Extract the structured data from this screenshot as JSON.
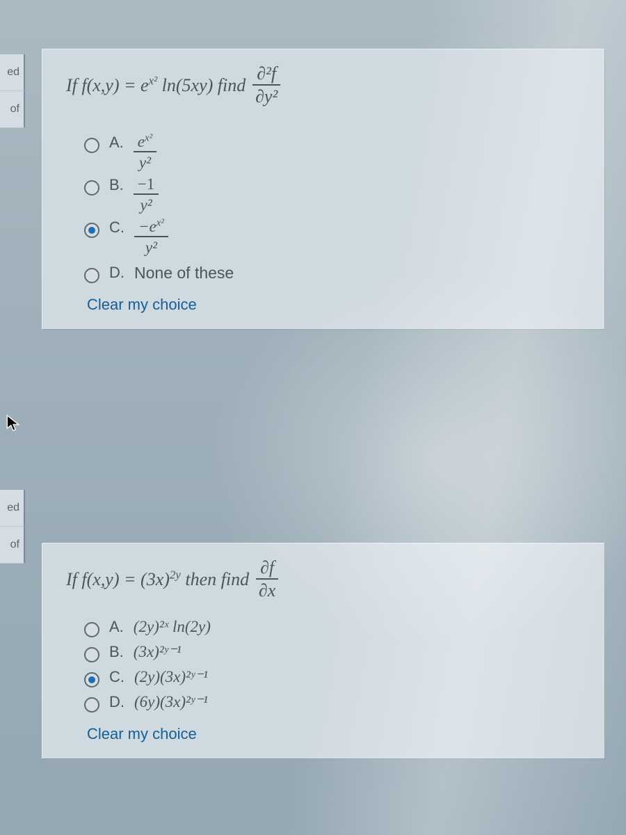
{
  "sidebar": {
    "ed1": "ed",
    "of1": "of",
    "ed2": "ed",
    "of2": "of"
  },
  "q1": {
    "stem_a": "If f(x,y) = e",
    "stem_b": " ln(5xy) find ",
    "frac_top": "∂²f",
    "frac_bot": "∂y²",
    "A": {
      "letter": "A.",
      "top": "e",
      "bot": "y²"
    },
    "B": {
      "letter": "B.",
      "top": "−1",
      "bot": "y²"
    },
    "C": {
      "letter": "C.",
      "top": "−e",
      "bot": "y²"
    },
    "D": {
      "letter": "D.",
      "text": "None of these"
    },
    "selected": "C",
    "clear": "Clear my choice"
  },
  "q2": {
    "stem_a": "If f(x,y) = (3x)",
    "stem_b": " then find ",
    "frac_top": "∂f",
    "frac_bot": "∂x",
    "A": {
      "letter": "A.",
      "text": "(2y)²ˣ ln(2y)"
    },
    "B": {
      "letter": "B.",
      "text": "(3x)²ʸ⁻¹"
    },
    "C": {
      "letter": "C.",
      "text": "(2y)(3x)²ʸ⁻¹"
    },
    "D": {
      "letter": "D.",
      "text": "(6y)(3x)²ʸ⁻¹"
    },
    "selected": "C",
    "clear": "Clear my choice"
  }
}
